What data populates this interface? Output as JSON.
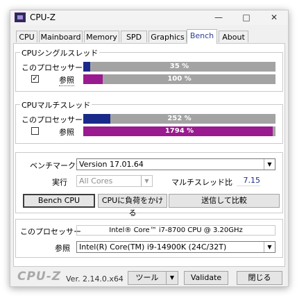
{
  "window": {
    "title": "CPU-Z",
    "controls": {
      "minimize": "—",
      "maximize": "□",
      "close": "✕"
    }
  },
  "tabs": [
    "CPU",
    "Mainboard",
    "Memory",
    "SPD",
    "Graphics",
    "Bench",
    "About"
  ],
  "active_tab": "Bench",
  "single_thread": {
    "group_label": "CPUシングルスレッド",
    "this_processor": {
      "label": "このプロセッサー",
      "value_text": "35 %",
      "fraction": 0.035,
      "color": "#1a2a8a"
    },
    "reference": {
      "label": "参照",
      "checked": true,
      "check_mark": "✓",
      "value_text": "100 %",
      "fraction": 0.1,
      "color": "#9a1a8f"
    }
  },
  "multi_thread": {
    "group_label": "CPUマルチスレッド",
    "this_processor": {
      "label": "このプロセッサー",
      "value_text": "252 %",
      "fraction": 0.14,
      "color": "#1a2a8a"
    },
    "reference": {
      "label": "参照",
      "checked": false,
      "value_text": "1794 %",
      "fraction": 0.985,
      "color": "#9a1a8f"
    }
  },
  "bench": {
    "benchmark_label": "ベンチマーク",
    "benchmark_value": "Version 17.01.64",
    "run_label": "実行",
    "run_value": "All Cores",
    "mt_ratio_label": "マルチスレッド比",
    "mt_ratio_value": "7.15",
    "bench_cpu_button": "Bench CPU",
    "stress_button": "CPUに負荷をかける",
    "submit_button": "送信して比較"
  },
  "processor": {
    "this_label": "このプロセッサー",
    "this_value": "Intel® Core™ i7-8700 CPU @ 3.20GHz",
    "ref_label": "参照",
    "ref_value": "Intel(R) Core(TM) i9-14900K (24C/32T)"
  },
  "footer": {
    "logo": "CPU-Z",
    "version": "Ver. 2.14.0.x64",
    "tools_button": "ツール",
    "validate_button": "Validate",
    "close_button": "閉じる"
  },
  "icons": {
    "dropdown": "▼"
  }
}
